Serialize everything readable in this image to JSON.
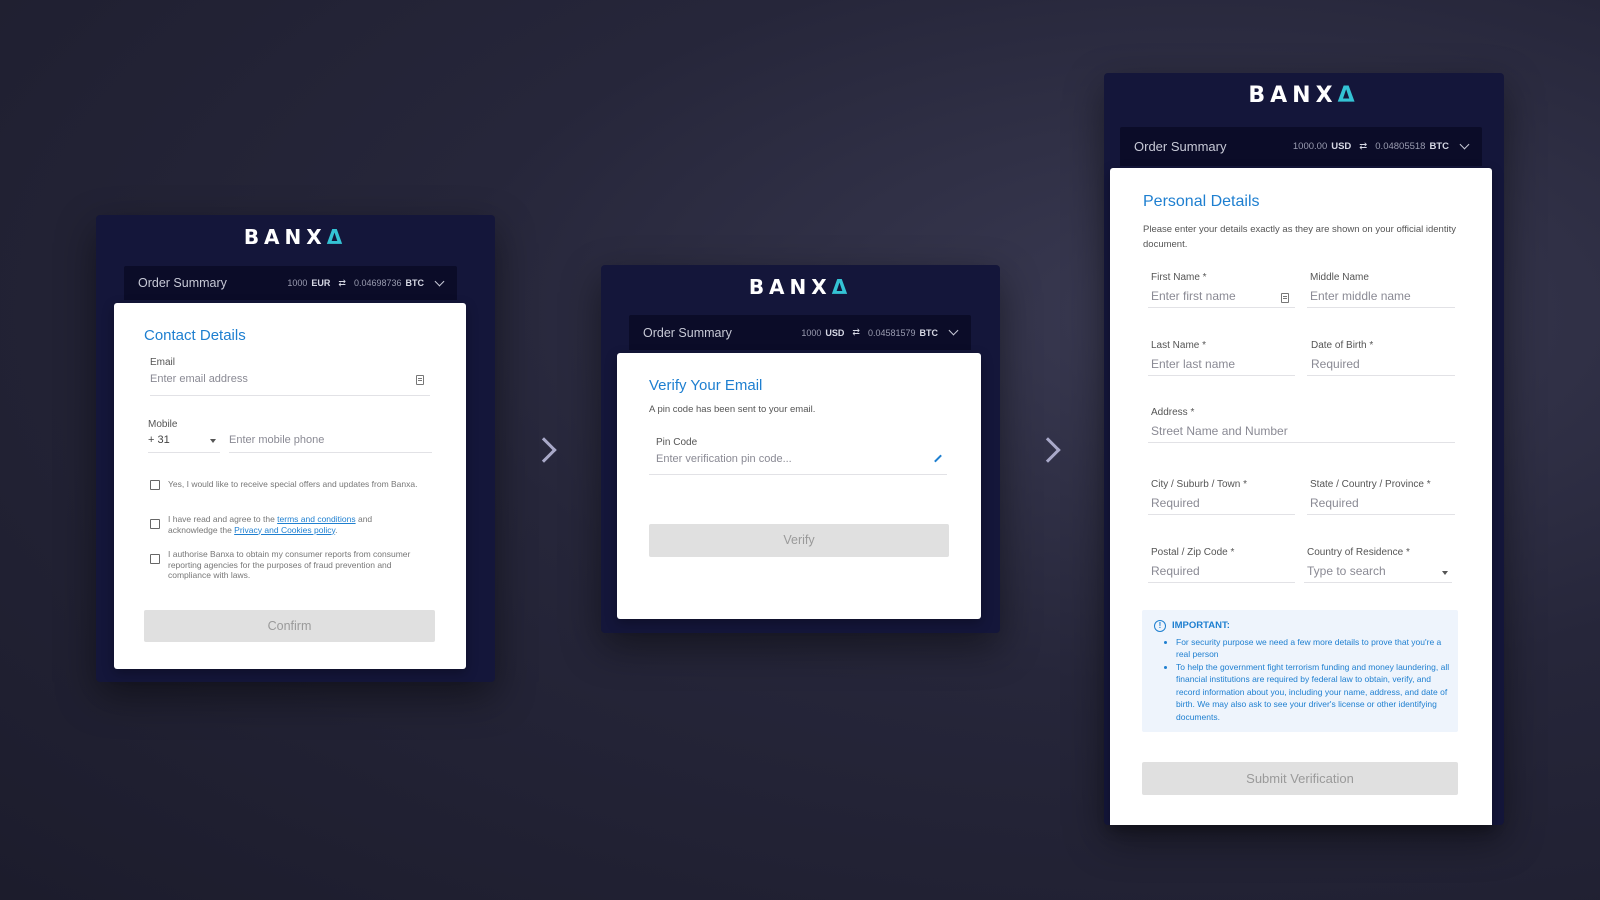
{
  "brand": {
    "logo_text": "BANX",
    "logo_mark": "Δ",
    "accent": "#1e7fd0",
    "teal": "#34c3d4"
  },
  "screens": [
    {
      "order_summary": {
        "label": "Order Summary",
        "fiat_amount": "1000",
        "fiat_currency": "EUR",
        "crypto_amount": "0.04698736",
        "crypto_currency": "BTC"
      },
      "title": "Contact Details",
      "email": {
        "label": "Email",
        "placeholder": "Enter email address"
      },
      "mobile": {
        "label": "Mobile",
        "country_code": "+ 31",
        "placeholder": "Enter mobile phone"
      },
      "checkboxes": {
        "offers": "Yes, I would like to receive special offers and updates from Banxa.",
        "terms_pre": "I have read and agree to the ",
        "terms_link": "terms and conditions",
        "terms_mid": " and acknowledge the ",
        "privacy_link": "Privacy and Cookies policy",
        "terms_post": ".",
        "authorise": "I authorise Banxa to obtain my consumer reports from consumer reporting agencies for the purposes of fraud prevention and compliance with laws."
      },
      "button": "Confirm"
    },
    {
      "order_summary": {
        "label": "Order Summary",
        "fiat_amount": "1000",
        "fiat_currency": "USD",
        "crypto_amount": "0.04581579",
        "crypto_currency": "BTC"
      },
      "title": "Verify Your Email",
      "subtitle": "A pin code has been sent to your email.",
      "pin": {
        "label": "Pin Code",
        "placeholder": "Enter verification pin code..."
      },
      "button": "Verify"
    },
    {
      "order_summary": {
        "label": "Order Summary",
        "fiat_amount": "1000.00",
        "fiat_currency": "USD",
        "crypto_amount": "0.04805518",
        "crypto_currency": "BTC"
      },
      "title": "Personal Details",
      "subtitle": "Please enter your details exactly as they are shown on your official identity document.",
      "fields": {
        "first_name": {
          "label": "First Name *",
          "placeholder": "Enter first name"
        },
        "middle_name": {
          "label": "Middle Name",
          "placeholder": "Enter middle name"
        },
        "last_name": {
          "label": "Last Name *",
          "placeholder": "Enter last name"
        },
        "dob": {
          "label": "Date of Birth *",
          "placeholder": "Required"
        },
        "address": {
          "label": "Address *",
          "placeholder": "Street Name and Number"
        },
        "city": {
          "label": "City / Suburb / Town *",
          "placeholder": "Required"
        },
        "state": {
          "label": "State / Country / Province *",
          "placeholder": "Required"
        },
        "postal": {
          "label": "Postal / Zip Code *",
          "placeholder": "Required"
        },
        "country": {
          "label": "Country of Residence *",
          "placeholder": "Type to search"
        }
      },
      "important": {
        "heading": "IMPORTANT:",
        "items": [
          "For security purpose we need a few more details to prove that you're a real person",
          "To help the government fight terrorism funding and money laundering, all financial institutions are required by federal law to obtain, verify, and record information about you, including your name, address, and date of birth. We may also ask to see your driver's license or other identifying documents."
        ]
      },
      "button": "Submit Verification"
    }
  ]
}
